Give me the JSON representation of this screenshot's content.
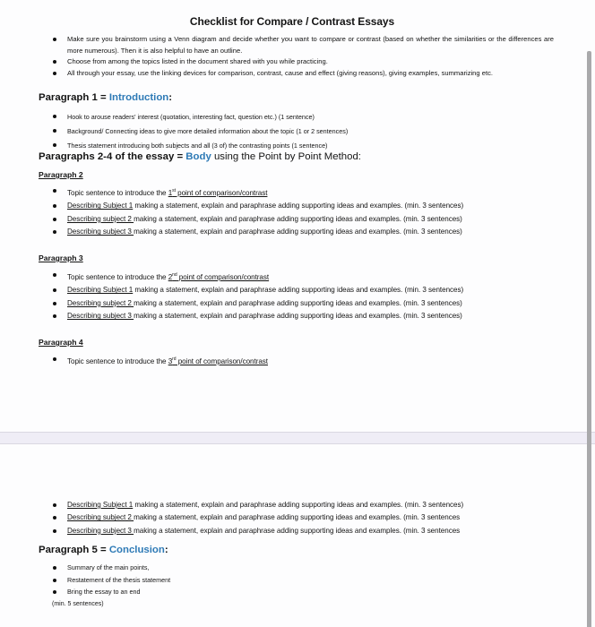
{
  "document": {
    "title": "Checklist for Compare / Contrast Essays",
    "intro_bullets": [
      "Make sure you brainstorm using a Venn diagram and decide whether you want to compare or contrast (based on whether the similarities or the differences are more numerous). Then it is also helpful to have an outline.",
      "Choose from among the topics listed in the document shared with you while practicing.",
      "All through your essay, use the linking devices for comparison, contrast, cause and effect (giving reasons), giving examples, summarizing etc."
    ],
    "paragraph1": {
      "heading_prefix": "Paragraph 1 = ",
      "heading_accent": "Introduction",
      "heading_suffix": ":",
      "bullets": [
        "Hook to arouse readers' interest (quotation, interesting fact, question etc.) (1 sentence)",
        "Background/ Connecting ideas to give more detailed information about the topic (1 or 2 sentences)",
        "Thesis statement introducing both subjects and all (3 of) the contrasting points (1 sentence)"
      ]
    },
    "body": {
      "heading_prefix": "Paragraphs 2-4 of the essay = ",
      "heading_accent": "Body",
      "heading_suffix": " using the Point by Point Method:"
    },
    "paragraph2": {
      "label": "Paragraph 2",
      "topic_prefix": "Topic sentence to introduce the ",
      "topic_num": "1",
      "topic_sup": "st",
      "topic_link": " point of comparison/contrast",
      "subjects": [
        {
          "label": "Describing Subject 1",
          "text": " making a statement, explain and paraphrase adding supporting ideas and examples. (min. 3 sentences)"
        },
        {
          "label": "Describing subject 2 ",
          "text": "making a statement, explain and paraphrase adding supporting ideas and examples. (min. 3 sentences)"
        },
        {
          "label": "Describing subject 3 ",
          "text": "making a statement, explain and paraphrase adding supporting ideas and examples. (min. 3 sentences)"
        }
      ]
    },
    "paragraph3": {
      "label": "Paragraph 3",
      "topic_prefix": "Topic sentence to introduce the ",
      "topic_num": "2",
      "topic_sup": "nd",
      "topic_link": " point of comparison/contrast",
      "subjects": [
        {
          "label": "Describing Subject 1",
          "text": " making a statement, explain and paraphrase adding supporting ideas and examples. (min. 3 sentences)"
        },
        {
          "label": "Describing subject 2 ",
          "text": "making a statement, explain and paraphrase adding supporting ideas and examples. (min. 3 sentences)"
        },
        {
          "label": "Describing subject 3 ",
          "text": "making a statement, explain and paraphrase adding supporting ideas and examples. (min. 3 sentences)"
        }
      ]
    },
    "paragraph4": {
      "label": "Paragraph 4",
      "topic_prefix": "Topic sentence to introduce the ",
      "topic_num": "3",
      "topic_sup": "rd",
      "topic_link": " point of comparison/contrast ",
      "subjects": [
        {
          "label": "Describing Subject 1",
          "text": " making a statement, explain and paraphrase adding supporting ideas and examples. (min. 3 sentences)"
        },
        {
          "label": "Describing subject 2 ",
          "text": "making a statement, explain and paraphrase adding supporting ideas and examples. (min. 3 sentences"
        },
        {
          "label": "Describing subject 3 ",
          "text": "making a statement, explain and paraphrase adding supporting ideas and examples. (min. 3 sentences"
        }
      ]
    },
    "paragraph5": {
      "heading_prefix": "Paragraph 5 = ",
      "heading_accent": "Conclusion",
      "heading_suffix": ":",
      "bullets": [
        "Summary of the main points,",
        "Restatement of the thesis statement",
        "Bring the essay to an end"
      ],
      "note": "(min. 5 sentences)"
    }
  },
  "colors": {
    "accent": "#2e7ab6",
    "page_break": "#efedf6",
    "scrollbar": "#a9a9ab"
  }
}
